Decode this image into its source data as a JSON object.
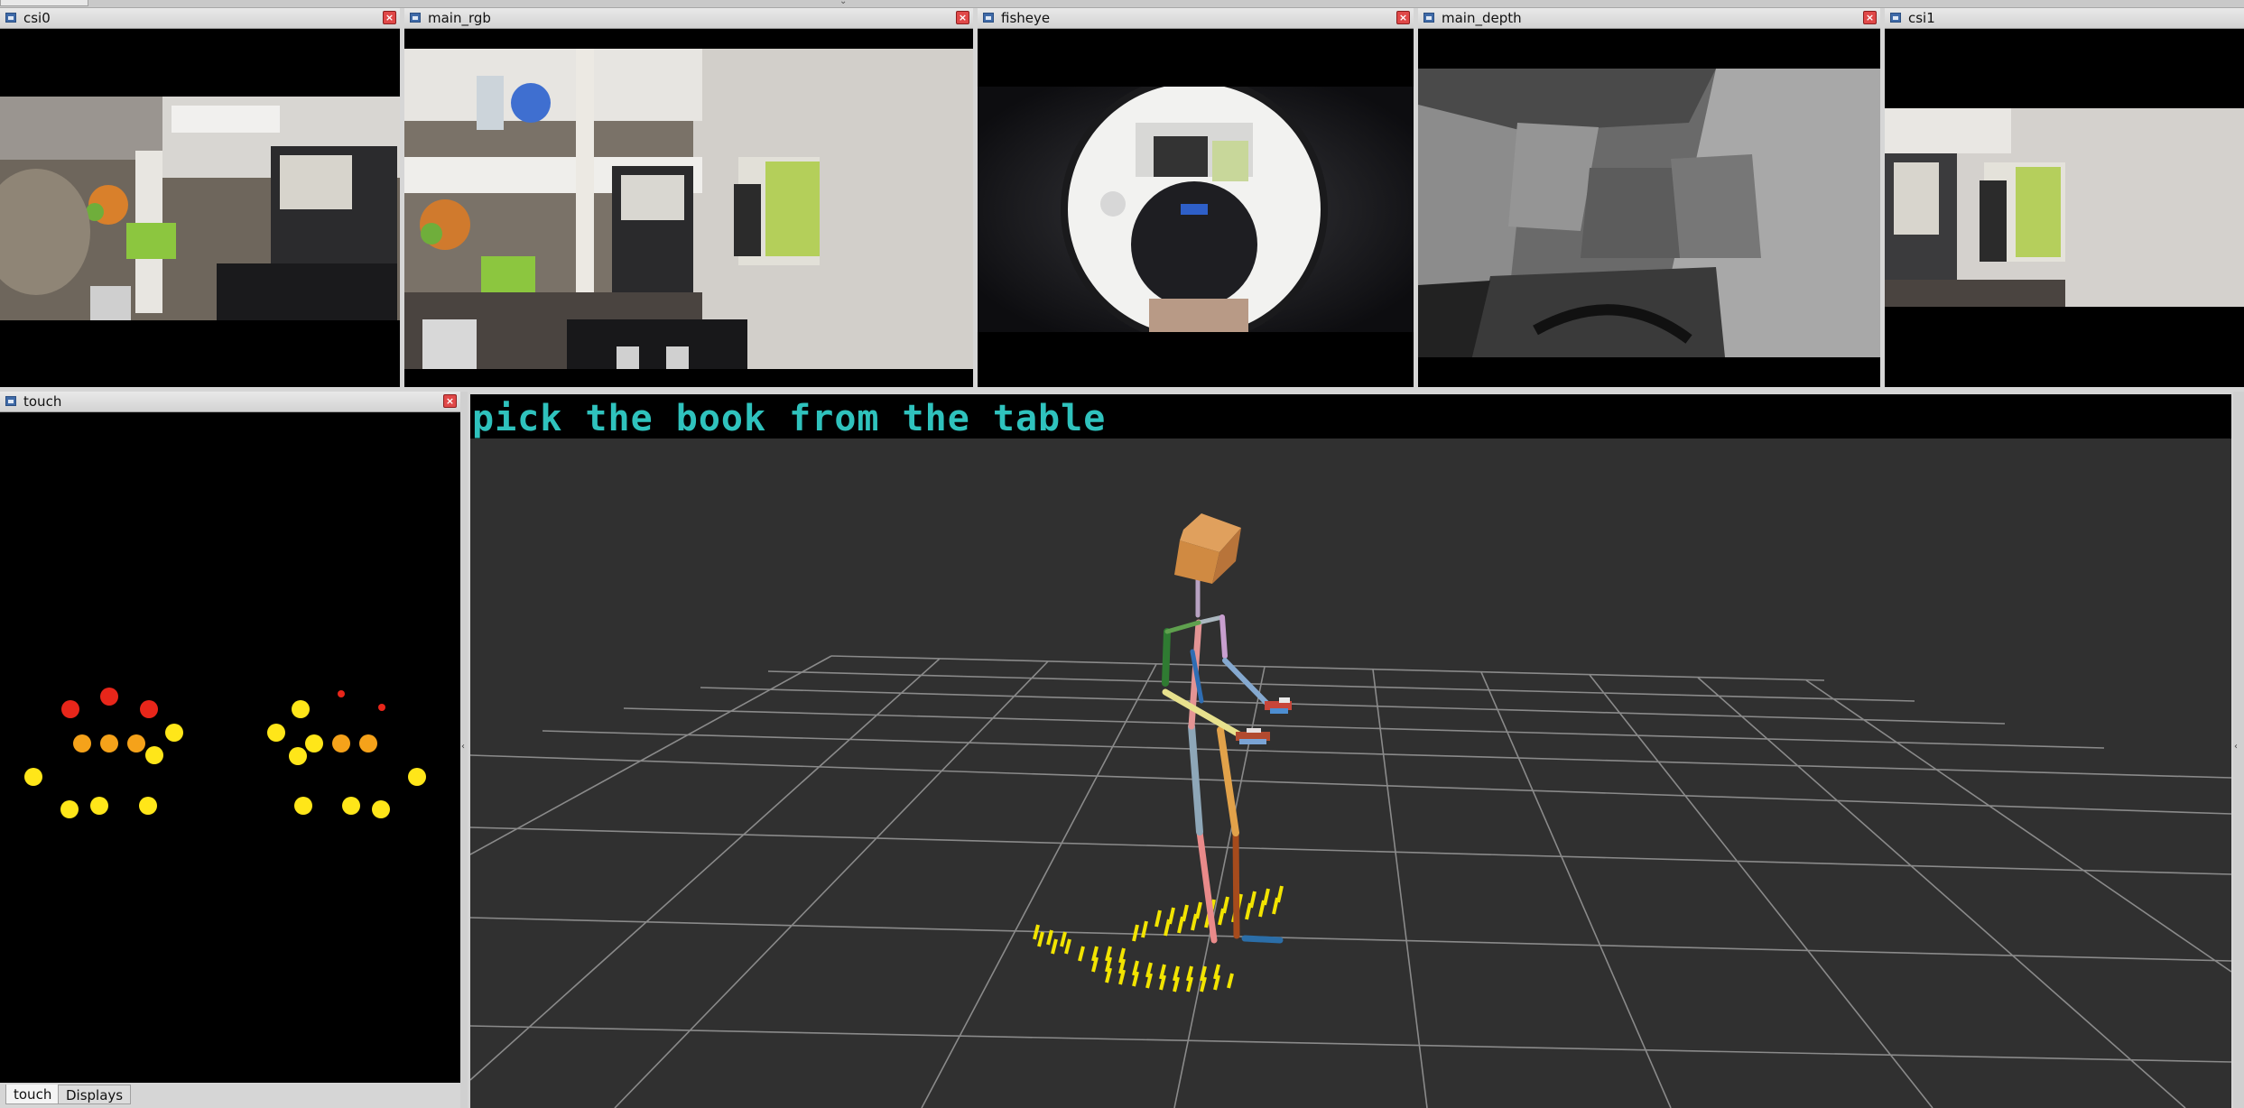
{
  "panels": {
    "csi0": {
      "title": "csi0"
    },
    "main_rgb": {
      "title": "main_rgb"
    },
    "fisheye": {
      "title": "fisheye"
    },
    "main_depth": {
      "title": "main_depth"
    },
    "csi1": {
      "title": "csi1"
    },
    "touch": {
      "title": "touch"
    }
  },
  "bottom_tabs": {
    "touch": "touch",
    "displays": "Displays"
  },
  "rviz": {
    "command_text": "pick the book from the table"
  },
  "colors": {
    "command_text": "#2fc2bd",
    "grid": "#8a8a8a",
    "background_3d": "#303030",
    "touch_high": "#e8261a",
    "touch_mid": "#f5a21a",
    "touch_low": "#ffe619"
  },
  "icons": {
    "panel_icon": "window-icon",
    "close": "close-icon"
  }
}
